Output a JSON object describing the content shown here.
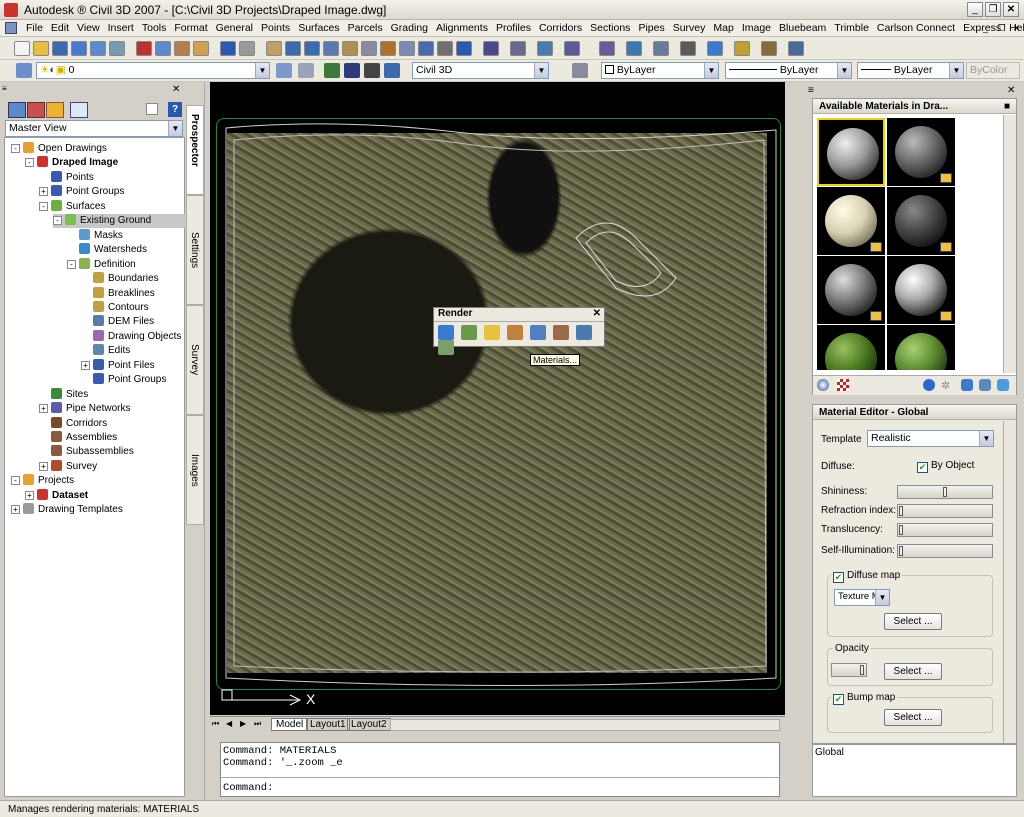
{
  "window": {
    "title": "Autodesk ® Civil 3D 2007 - [C:\\Civil 3D Projects\\Draped Image.dwg]"
  },
  "menu": [
    "File",
    "Edit",
    "View",
    "Insert",
    "Tools",
    "Format",
    "General",
    "Points",
    "Surfaces",
    "Parcels",
    "Grading",
    "Alignments",
    "Profiles",
    "Corridors",
    "Sections",
    "Pipes",
    "Survey",
    "Map",
    "Image",
    "Bluebeam",
    "Trimble",
    "Carlson Connect",
    "Express",
    "Help"
  ],
  "toolbar": {
    "layer_value": "0",
    "style_value": "Civil 3D",
    "color_value": "ByLayer",
    "linetype_value": "ByLayer",
    "lineweight_value": "ByLayer",
    "plotstyle_value": "ByColor"
  },
  "prospector": {
    "view_select": "Master View",
    "tree": [
      {
        "label": "Open Drawings",
        "level": 0,
        "icon": "drawings-icon"
      },
      {
        "label": "Draped Image",
        "level": 1,
        "icon": "drawing-icon",
        "bold": true
      },
      {
        "label": "Points",
        "level": 2,
        "icon": "points-icon"
      },
      {
        "label": "Point Groups",
        "level": 2,
        "icon": "point-groups-icon"
      },
      {
        "label": "Surfaces",
        "level": 2,
        "icon": "surfaces-icon"
      },
      {
        "label": "Existing Ground",
        "level": 3,
        "icon": "surface-icon",
        "selected": true
      },
      {
        "label": "Masks",
        "level": 4,
        "icon": "masks-icon"
      },
      {
        "label": "Watersheds",
        "level": 4,
        "icon": "watersheds-icon"
      },
      {
        "label": "Definition",
        "level": 4,
        "icon": "definition-icon"
      },
      {
        "label": "Boundaries",
        "level": 5,
        "icon": "boundaries-icon"
      },
      {
        "label": "Breaklines",
        "level": 5,
        "icon": "breaklines-icon"
      },
      {
        "label": "Contours",
        "level": 5,
        "icon": "contours-icon"
      },
      {
        "label": "DEM Files",
        "level": 5,
        "icon": "dem-files-icon"
      },
      {
        "label": "Drawing Objects",
        "level": 5,
        "icon": "drawing-objects-icon"
      },
      {
        "label": "Edits",
        "level": 5,
        "icon": "edits-icon"
      },
      {
        "label": "Point Files",
        "level": 5,
        "icon": "point-files-icon"
      },
      {
        "label": "Point Groups",
        "level": 5,
        "icon": "point-groups-icon"
      },
      {
        "label": "Sites",
        "level": 2,
        "icon": "sites-icon"
      },
      {
        "label": "Pipe Networks",
        "level": 2,
        "icon": "pipe-networks-icon"
      },
      {
        "label": "Corridors",
        "level": 2,
        "icon": "corridors-icon"
      },
      {
        "label": "Assemblies",
        "level": 2,
        "icon": "assemblies-icon"
      },
      {
        "label": "Subassemblies",
        "level": 2,
        "icon": "subassemblies-icon"
      },
      {
        "label": "Survey",
        "level": 2,
        "icon": "survey-icon"
      },
      {
        "label": "Projects",
        "level": 0,
        "icon": "projects-icon"
      },
      {
        "label": "Dataset",
        "level": 1,
        "icon": "dataset-icon",
        "bold": true
      },
      {
        "label": "Drawing Templates",
        "level": 0,
        "icon": "templates-icon"
      }
    ],
    "tabs": [
      "Prospector",
      "Settings",
      "Survey",
      "Images"
    ]
  },
  "render_toolbar": {
    "title": "Render",
    "tooltip": "Materials..."
  },
  "layout_tabs": [
    "Model",
    "Layout1",
    "Layout2"
  ],
  "command": {
    "history": [
      "Command: MATERIALS",
      "Command: '_.zoom _e"
    ],
    "prompt": "Command:"
  },
  "materials_panel": {
    "title": "Available Materials in Dra..."
  },
  "material_editor": {
    "title": "Material Editor - Global",
    "template_label": "Template",
    "template_value": "Realistic",
    "diffuse_label": "Diffuse:",
    "by_object_label": "By Object",
    "shininess_label": "Shininess:",
    "refraction_label": "Refraction index:",
    "translucency_label": "Translucency:",
    "self_illum_label": "Self-Illumination:",
    "diffuse_map_label": "Diffuse map",
    "texture_value": "Texture M",
    "select_label": "Select ...",
    "opacity_label": "Opacity",
    "bump_map_label": "Bump map",
    "footer": "Global",
    "shininess_level": 0.5
  },
  "status": {
    "text": "Manages rendering materials: MATERIALS"
  }
}
